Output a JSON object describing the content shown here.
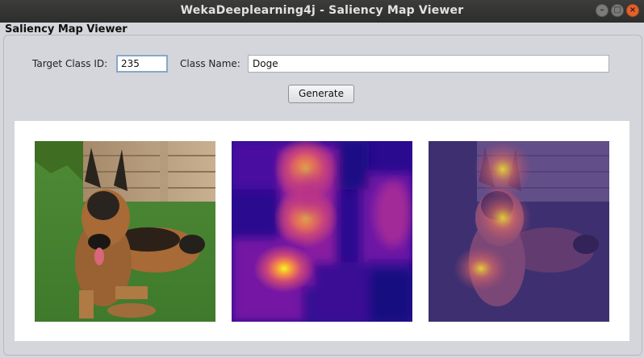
{
  "window": {
    "title": "WekaDeeplearning4j - Saliency Map Viewer",
    "controls": [
      "minimize",
      "maximize",
      "close"
    ]
  },
  "panel": {
    "title": "Saliency Map Viewer"
  },
  "form": {
    "target_class_label": "Target Class ID:",
    "target_class_value": "235",
    "class_name_label": "Class Name:",
    "class_name_value": "Doge",
    "generate_label": "Generate"
  },
  "images": [
    {
      "role": "original image",
      "content": "german-shepherd-dog-on-grass"
    },
    {
      "role": "saliency heatmap",
      "content": "plasma-colormap-heatmap"
    },
    {
      "role": "heatmap overlay",
      "content": "dog-with-heatmap-overlay"
    }
  ],
  "colors": {
    "titlebar": "#2d2d2b",
    "close_button": "#e2622c",
    "heatmap_low": "#0d0887",
    "heatmap_mid": "#cc4778",
    "heatmap_high": "#f0f921"
  }
}
